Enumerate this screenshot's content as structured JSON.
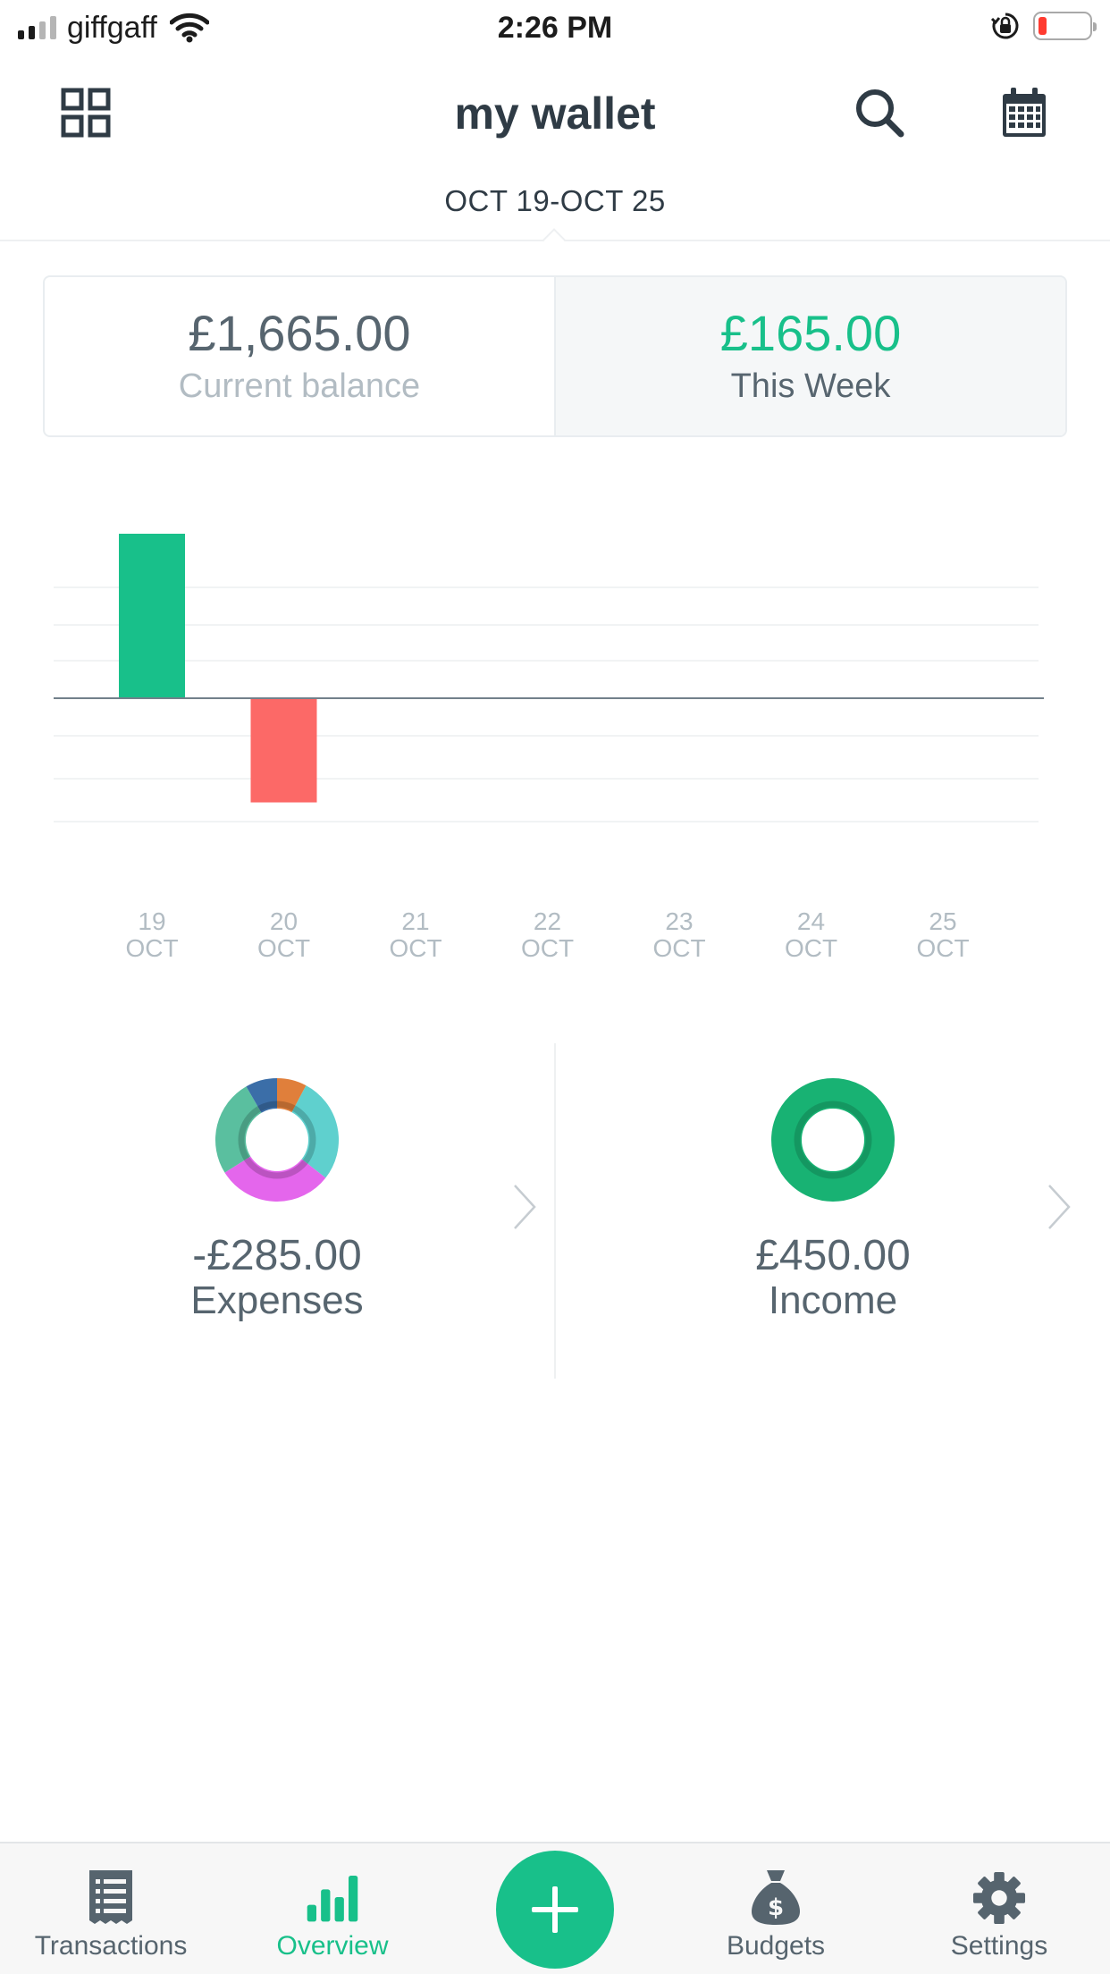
{
  "status_bar": {
    "carrier": "giffgaff",
    "time": "2:26 PM",
    "icons": [
      "signal-icon",
      "wifi-icon",
      "orientation-lock-icon",
      "battery-icon"
    ]
  },
  "header": {
    "title": "my wallet",
    "left_icon": "dashboard-grid-icon",
    "right_icons": [
      "search-icon",
      "calendar-icon"
    ],
    "date_range": "OCT 19-OCT 25"
  },
  "balance": {
    "current_amount": "£1,665.00",
    "current_label": "Current balance",
    "week_amount": "£165.00",
    "week_label": "This Week"
  },
  "chart_data": {
    "type": "bar",
    "categories": [
      "19 OCT",
      "20 OCT",
      "21 OCT",
      "22 OCT",
      "23 OCT",
      "24 OCT",
      "25 OCT"
    ],
    "day_labels": [
      "19",
      "20",
      "21",
      "22",
      "23",
      "24",
      "25"
    ],
    "month_labels": [
      "OCT",
      "OCT",
      "OCT",
      "OCT",
      "OCT",
      "OCT",
      "OCT"
    ],
    "values": [
      450,
      -285,
      0,
      0,
      0,
      0,
      0
    ],
    "ylim": [
      -300,
      450
    ],
    "positive_color": "#18c08a",
    "negative_color": "#fc6967",
    "grid": true
  },
  "summary": {
    "expenses": {
      "amount": "-£285.00",
      "label": "Expenses",
      "segment_colors": [
        "#5fd0ce",
        "#e466ec",
        "#5abf9f",
        "#3b6ea8",
        "#e07f3b"
      ]
    },
    "income": {
      "amount": "£450.00",
      "label": "Income",
      "color": "#18b273"
    }
  },
  "bottom_nav": {
    "items": [
      {
        "label": "Transactions",
        "icon": "receipt-icon",
        "active": false
      },
      {
        "label": "Overview",
        "icon": "bar-chart-icon",
        "active": true
      },
      {
        "label": "Budgets",
        "icon": "money-bag-icon",
        "active": false
      },
      {
        "label": "Settings",
        "icon": "gear-icon",
        "active": false
      }
    ],
    "add_icon": "plus-icon"
  },
  "colors": {
    "accent": "#18c08a",
    "text_dark": "#2f3b45",
    "text_mid": "#57656f",
    "text_light": "#b2bcc3"
  }
}
